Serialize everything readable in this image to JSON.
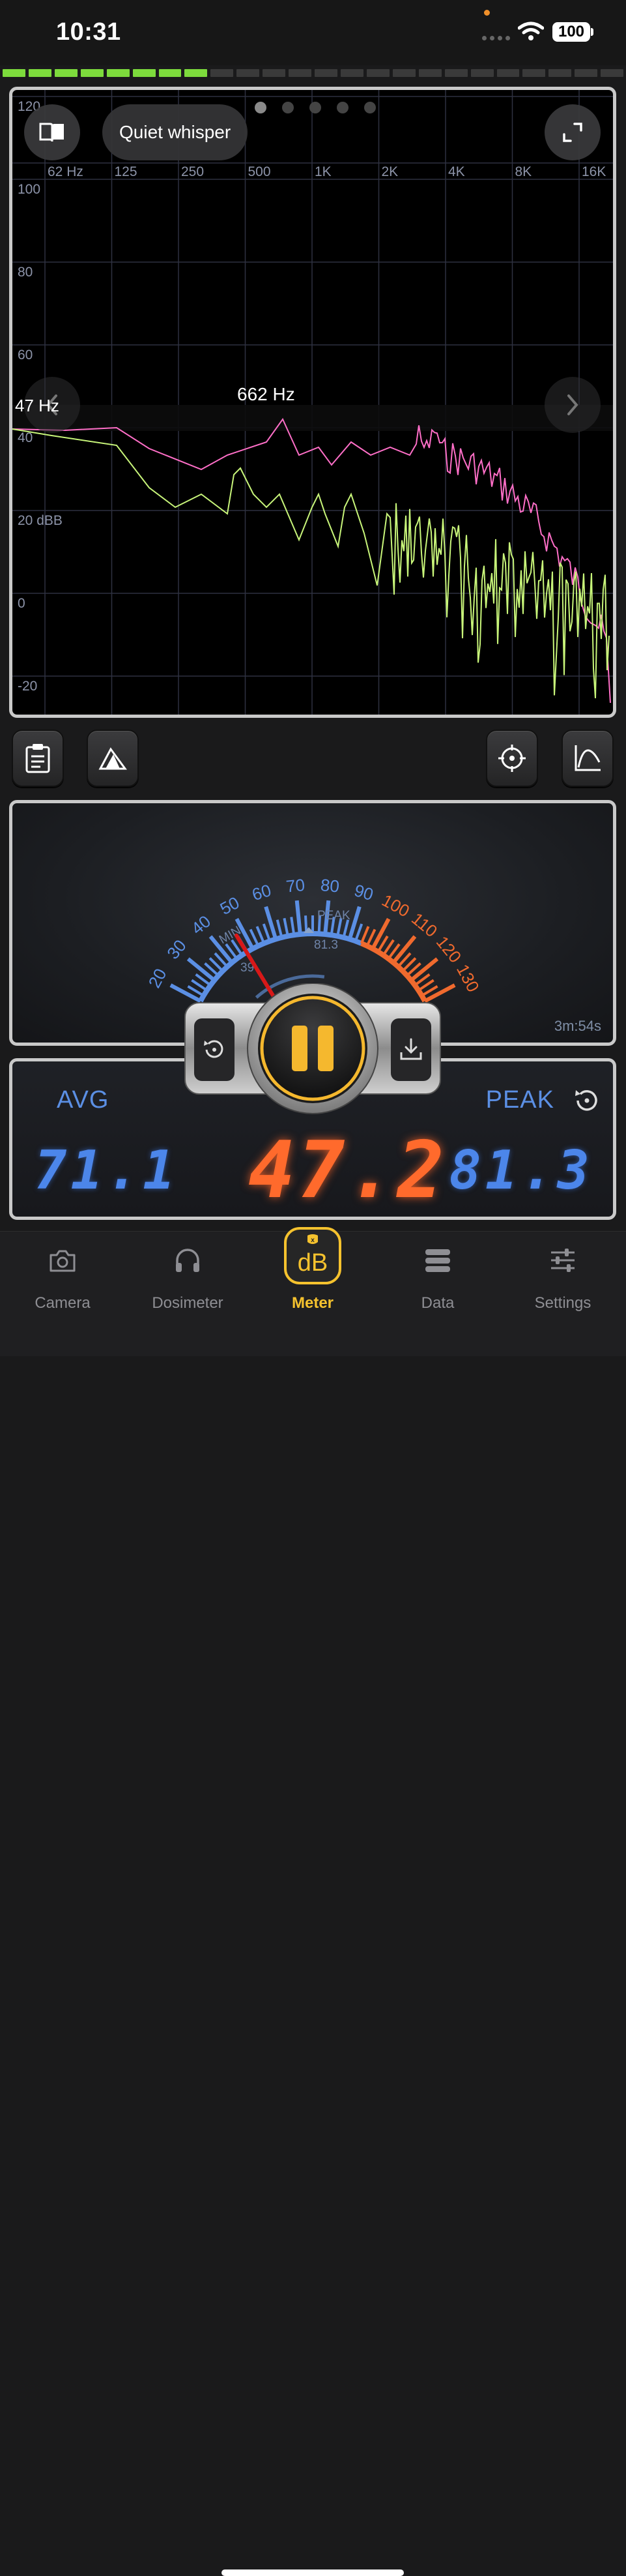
{
  "status_bar": {
    "time": "10:31",
    "battery": "100"
  },
  "spectrum": {
    "preset_label": "Quiet whisper",
    "peak_freq_label": "662 Hz",
    "cursor_freq_label": "47 Hz",
    "freq_ticks": [
      "62 Hz",
      "125",
      "250",
      "500",
      "1K",
      "2K",
      "4K",
      "8K",
      "16K"
    ],
    "db_ticks": [
      "120",
      "100",
      "80",
      "60",
      "40",
      "20 dBB",
      "0",
      "-20"
    ],
    "page_count": 5,
    "active_page": 0,
    "colors": {
      "peak_hold_line": "#ff6fc8",
      "live_line": "#c8f57a",
      "grid": "#2e3140"
    }
  },
  "meter": {
    "scale_labels": [
      "20",
      "30",
      "40",
      "50",
      "60",
      "70",
      "80",
      "90",
      "100",
      "110",
      "120",
      "130"
    ],
    "min_label": "MIN",
    "min_value": "39",
    "peak_label": "PEAK",
    "peak_marker_value": "81.3",
    "needle_db": 47.2,
    "elapsed": "3m:54s",
    "colors": {
      "low_scale": "#5b8fe4",
      "high_scale": "#f06a2e",
      "needle": "#d81818"
    }
  },
  "readout": {
    "avg_label": "AVG",
    "avg_value": "71.1",
    "current_value": "47.2",
    "peak_label": "PEAK",
    "peak_value": "81.3"
  },
  "tabs": [
    {
      "label": "Camera",
      "icon": "camera-icon"
    },
    {
      "label": "Dosimeter",
      "icon": "headphones-icon"
    },
    {
      "label": "Meter",
      "icon": "db-meter-icon",
      "active": true
    },
    {
      "label": "Data",
      "icon": "data-stack-icon"
    },
    {
      "label": "Settings",
      "icon": "sliders-icon"
    }
  ],
  "accent_color": "#f5c22e"
}
